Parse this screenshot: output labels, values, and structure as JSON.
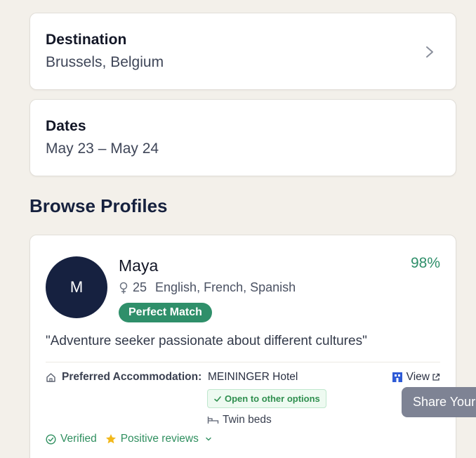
{
  "destination": {
    "label": "Destination",
    "value": "Brussels, Belgium"
  },
  "dates": {
    "label": "Dates",
    "value": "May 23 – May 24"
  },
  "browse": {
    "title": "Browse Profiles"
  },
  "profile": {
    "initial": "M",
    "name": "Maya",
    "age": "25",
    "languages": "English, French, Spanish",
    "match_label": "Perfect Match",
    "match_percent": "98%",
    "quote": "\"Adventure seeker passionate about different cultures\"",
    "accommodation": {
      "label": "Preferred Accommodation:",
      "hotel": "MEININGER Hotel",
      "view_label": "View",
      "open_label": "Open to other options",
      "beds": "Twin beds"
    },
    "verified": "Verified",
    "reviews": "Positive reviews"
  },
  "tooltip": {
    "text": "Share Your"
  },
  "colors": {
    "accent": "#2f8f6a",
    "navy": "#162140",
    "background": "#f3f0ea"
  }
}
